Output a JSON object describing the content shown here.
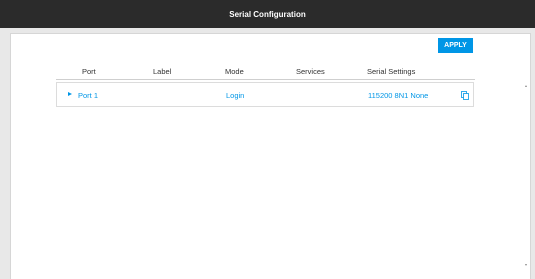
{
  "header": {
    "title": "Serial Configuration"
  },
  "toolbar": {
    "apply_label": "APPLY"
  },
  "table": {
    "columns": [
      "Port",
      "Label",
      "Mode",
      "Services",
      "Serial Settings"
    ],
    "rows": [
      {
        "port": "Port 1",
        "label": "",
        "mode": "Login",
        "services": "",
        "serial_settings": "115200 8N1 None"
      }
    ]
  },
  "colors": {
    "accent": "#0096e6",
    "topbar": "#2b2b2b"
  },
  "icons": {
    "expand": "caret-right-icon",
    "copy": "copy-icon"
  }
}
